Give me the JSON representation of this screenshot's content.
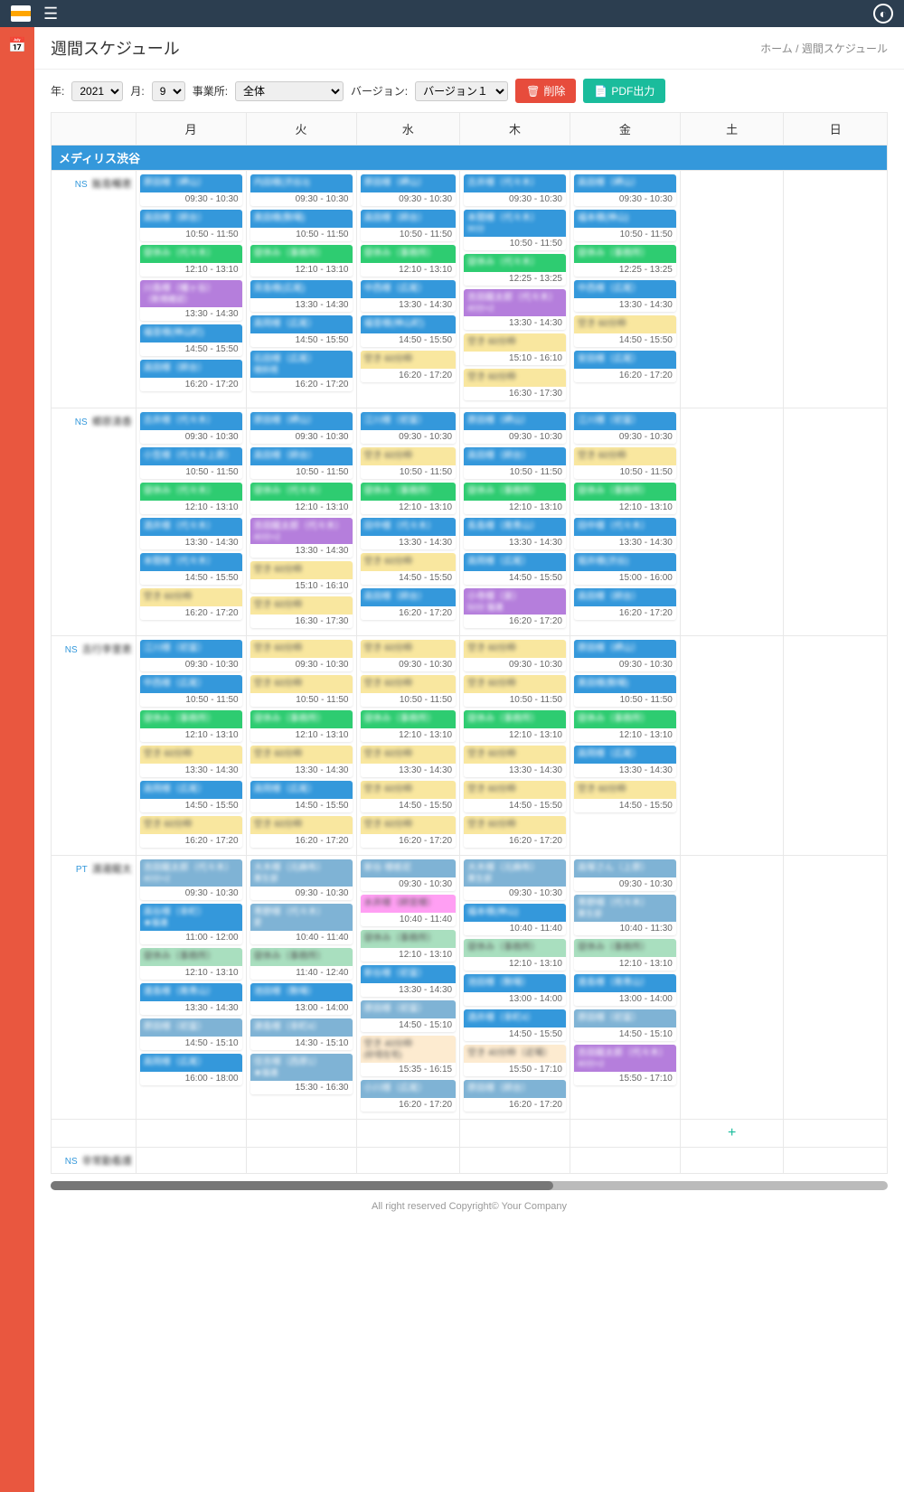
{
  "header": {
    "title": "週間スケジュール",
    "breadcrumb_home": "ホーム",
    "breadcrumb_sep": " / ",
    "breadcrumb_current": "週間スケジュール"
  },
  "toolbar": {
    "year_label": "年:",
    "year_value": "2021",
    "month_label": "月:",
    "month_value": "9",
    "office_label": "事業所:",
    "office_value": "全体",
    "version_label": "バージョン:",
    "version_value": "バージョン１",
    "delete_label": "削除",
    "pdf_label": "PDF出力"
  },
  "days": [
    "",
    "月",
    "火",
    "水",
    "木",
    "金",
    "土",
    "日"
  ],
  "group": {
    "name": "メディリス渋谷"
  },
  "staff": [
    {
      "tag": "NS",
      "name": "飯島暢恵",
      "days": [
        [
          {
            "c": "blue",
            "t": "原田様（岬山）",
            "time": "09:30 - 10:30"
          },
          {
            "c": "blue",
            "t": "高田様（師台）",
            "time": "10:50 - 11:50"
          },
          {
            "c": "green",
            "t": "昼休み（代々木）",
            "time": "12:10 - 13:10"
          },
          {
            "c": "purple",
            "t": "川島様（幡ヶ谷）",
            "s": "（新規確認）",
            "time": "13:30 - 14:30"
          },
          {
            "c": "blue",
            "t": "福音様(神山町)",
            "time": "14:50 - 15:50"
          },
          {
            "c": "blue",
            "t": "高田様（師台）",
            "time": "16:20 - 17:20"
          }
        ],
        [
          {
            "c": "blue",
            "t": "内田様(渋谷3)",
            "time": "09:30 - 10:30"
          },
          {
            "c": "blue",
            "t": "奥田様(駒場)",
            "time": "10:50 - 11:50"
          },
          {
            "c": "green",
            "t": "昼休み（事務所）",
            "time": "12:10 - 13:10"
          },
          {
            "c": "blue",
            "t": "貝島様(広尾)",
            "time": "13:30 - 14:30"
          },
          {
            "c": "blue",
            "t": "高岡様（広尾）",
            "time": "14:50 - 15:50"
          },
          {
            "c": "blue",
            "t": "石田様（広尾）",
            "s": "様斜視",
            "time": "16:20 - 17:20"
          }
        ],
        [
          {
            "c": "blue",
            "t": "原田様（岬山）",
            "time": "09:30 - 10:30"
          },
          {
            "c": "blue",
            "t": "高田様（師台）",
            "time": "10:50 - 11:50"
          },
          {
            "c": "green",
            "t": "昼休み（事務所）",
            "time": "12:10 - 13:10"
          },
          {
            "c": "blue",
            "t": "中西様（広尾）",
            "time": "13:30 - 14:30"
          },
          {
            "c": "blue",
            "t": "福音様(神山町)",
            "time": "14:50 - 15:50"
          },
          {
            "c": "yellow",
            "t": "空き 60分枠",
            "time": "16:20 - 17:20"
          }
        ],
        [
          {
            "c": "blue",
            "t": "古井様（代々木）",
            "time": "09:30 - 10:30"
          },
          {
            "c": "blue",
            "t": "本間様（代々木）",
            "s": "90分",
            "time": "10:50 - 11:50"
          },
          {
            "c": "green",
            "t": "昼休み（代々木）",
            "time": "12:25 - 13:25"
          },
          {
            "c": "purple",
            "t": "吉田龍太郎（代々木）",
            "s": "40分×2",
            "time": "13:30 - 14:30"
          },
          {
            "c": "yellow",
            "t": "空き 60分枠",
            "time": "15:10 - 16:10"
          },
          {
            "c": "yellow",
            "t": "空き 60分枠",
            "time": "16:30 - 17:30"
          }
        ],
        [
          {
            "c": "blue",
            "t": "高田様（岬山）",
            "time": "09:30 - 10:30"
          },
          {
            "c": "blue",
            "t": "福本様(神山)",
            "time": "10:50 - 11:50"
          },
          {
            "c": "green",
            "t": "昼休み（事務所）",
            "time": "12:25 - 13:25"
          },
          {
            "c": "blue",
            "t": "中西様（広尾）",
            "time": "13:30 - 14:30"
          },
          {
            "c": "yellow",
            "t": "空き 60分枠",
            "time": "14:50 - 15:50"
          },
          {
            "c": "blue",
            "t": "安田様（広尾）",
            "time": "16:20 - 17:20"
          }
        ],
        [],
        []
      ]
    },
    {
      "tag": "NS",
      "name": "郷原清香",
      "days": [
        [
          {
            "c": "blue",
            "t": "古井様（代々木）",
            "time": "09:30 - 10:30"
          },
          {
            "c": "blue",
            "t": "小笠様（代々木上原）",
            "time": "10:50 - 11:50"
          },
          {
            "c": "green",
            "t": "昼休み（代々木）",
            "time": "12:10 - 13:10"
          },
          {
            "c": "blue",
            "t": "酒井様（代々木）",
            "time": "13:30 - 14:30"
          },
          {
            "c": "blue",
            "t": "本間様（代々木）",
            "time": "14:50 - 15:50"
          },
          {
            "c": "yellow",
            "t": "空き 60分枠",
            "time": "16:20 - 17:20"
          }
        ],
        [
          {
            "c": "blue",
            "t": "原田様（岬山）",
            "time": "09:30 - 10:30"
          },
          {
            "c": "blue",
            "t": "高田様（師台）",
            "time": "10:50 - 11:50"
          },
          {
            "c": "green",
            "t": "昼休み（代々木）",
            "time": "12:10 - 13:10"
          },
          {
            "c": "purple",
            "t": "吉田龍太郎（代々木）",
            "s": "40分×2",
            "time": "13:30 - 14:30"
          },
          {
            "c": "yellow",
            "t": "空き 60分枠",
            "time": "15:10 - 16:10"
          },
          {
            "c": "yellow",
            "t": "空き 60分枠",
            "time": "16:30 - 17:30"
          }
        ],
        [
          {
            "c": "blue",
            "t": "江川様（初富）",
            "time": "09:30 - 10:30"
          },
          {
            "c": "yellow",
            "t": "空き 60分枠",
            "time": "10:50 - 11:50"
          },
          {
            "c": "green",
            "t": "昼休み（事務所）",
            "time": "12:10 - 13:10"
          },
          {
            "c": "blue",
            "t": "田中様（代々木）",
            "time": "13:30 - 14:30"
          },
          {
            "c": "yellow",
            "t": "空き 60分枠",
            "time": "14:50 - 15:50"
          },
          {
            "c": "blue",
            "t": "高田様（師台）",
            "time": "16:20 - 17:20"
          }
        ],
        [
          {
            "c": "blue",
            "t": "原田様（岬山）",
            "time": "09:30 - 10:30"
          },
          {
            "c": "blue",
            "t": "高田様（師台）",
            "time": "10:50 - 11:50"
          },
          {
            "c": "green",
            "t": "昼休み（事務所）",
            "time": "12:10 - 13:10"
          },
          {
            "c": "blue",
            "t": "長島様（南青山）",
            "time": "13:30 - 14:30"
          },
          {
            "c": "blue",
            "t": "高岡様（広尾）",
            "time": "14:50 - 15:50"
          },
          {
            "c": "purple",
            "t": "小寺様（泉）",
            "s": "50分 猫連",
            "time": "16:20 - 17:20"
          }
        ],
        [
          {
            "c": "blue",
            "t": "江川様（初富）",
            "time": "09:30 - 10:30"
          },
          {
            "c": "yellow",
            "t": "空き 60分枠",
            "time": "10:50 - 11:50"
          },
          {
            "c": "green",
            "t": "昼休み（事務所）",
            "time": "12:10 - 13:10"
          },
          {
            "c": "blue",
            "t": "田中様（代々木）",
            "time": "13:30 - 14:30"
          },
          {
            "c": "blue",
            "t": "堀井様(渋谷)",
            "time": "15:00 - 16:00"
          },
          {
            "c": "blue",
            "t": "高田様（師台）",
            "time": "16:20 - 17:20"
          }
        ],
        [],
        []
      ]
    },
    {
      "tag": "NS",
      "name": "吉行李里恵",
      "days": [
        [
          {
            "c": "blue",
            "t": "江川様（初富）",
            "time": "09:30 - 10:30"
          },
          {
            "c": "blue",
            "t": "中西様（広尾）",
            "time": "10:50 - 11:50"
          },
          {
            "c": "green",
            "t": "昼休み（事務所）",
            "time": "12:10 - 13:10"
          },
          {
            "c": "yellow",
            "t": "空き 60分枠",
            "time": "13:30 - 14:30"
          },
          {
            "c": "blue",
            "t": "高岡様（広尾）",
            "time": "14:50 - 15:50"
          },
          {
            "c": "yellow",
            "t": "空き 60分枠",
            "time": "16:20 - 17:20"
          }
        ],
        [
          {
            "c": "yellow",
            "t": "空き 60分枠",
            "time": "09:30 - 10:30"
          },
          {
            "c": "yellow",
            "t": "空き 60分枠",
            "time": "10:50 - 11:50"
          },
          {
            "c": "green",
            "t": "昼休み（事務所）",
            "time": "12:10 - 13:10"
          },
          {
            "c": "yellow",
            "t": "空き 60分枠",
            "time": "13:30 - 14:30"
          },
          {
            "c": "blue",
            "t": "高岡様（広尾）",
            "time": "14:50 - 15:50"
          },
          {
            "c": "yellow",
            "t": "空き 60分枠",
            "time": "16:20 - 17:20"
          }
        ],
        [
          {
            "c": "yellow",
            "t": "空き 60分枠",
            "time": "09:30 - 10:30"
          },
          {
            "c": "yellow",
            "t": "空き 60分枠",
            "time": "10:50 - 11:50"
          },
          {
            "c": "green",
            "t": "昼休み（事務所）",
            "time": "12:10 - 13:10"
          },
          {
            "c": "yellow",
            "t": "空き 60分枠",
            "time": "13:30 - 14:30"
          },
          {
            "c": "yellow",
            "t": "空き 60分枠",
            "time": "14:50 - 15:50"
          },
          {
            "c": "yellow",
            "t": "空き 60分枠",
            "time": "16:20 - 17:20"
          }
        ],
        [
          {
            "c": "yellow",
            "t": "空き 60分枠",
            "time": "09:30 - 10:30"
          },
          {
            "c": "yellow",
            "t": "空き 60分枠",
            "time": "10:50 - 11:50"
          },
          {
            "c": "green",
            "t": "昼休み（事務所）",
            "time": "12:10 - 13:10"
          },
          {
            "c": "yellow",
            "t": "空き 60分枠",
            "time": "13:30 - 14:30"
          },
          {
            "c": "yellow",
            "t": "空き 60分枠",
            "time": "14:50 - 15:50"
          },
          {
            "c": "yellow",
            "t": "空き 60分枠",
            "time": "16:20 - 17:20"
          }
        ],
        [
          {
            "c": "blue",
            "t": "原田様（岬山）",
            "time": "09:30 - 10:30"
          },
          {
            "c": "blue",
            "t": "奥田様(駒場)",
            "time": "10:50 - 11:50"
          },
          {
            "c": "green",
            "t": "昼休み（事務所）",
            "time": "12:10 - 13:10"
          },
          {
            "c": "blue",
            "t": "高岡様（広尾）",
            "time": "13:30 - 14:30"
          },
          {
            "c": "yellow",
            "t": "空き 60分枠",
            "time": "14:50 - 15:50"
          }
        ],
        [],
        []
      ]
    },
    {
      "tag": "PT",
      "name": "渡邊龍太",
      "days": [
        [
          {
            "c": "lblue",
            "t": "吉田龍太郎（代々木）",
            "s": "40分×2",
            "time": "09:30 - 10:30"
          },
          {
            "c": "blue",
            "t": "高谷様（幸町）",
            "s": "★猫連",
            "time": "11:00 - 12:00"
          },
          {
            "c": "lgreen",
            "t": "昼休み（事務所）",
            "time": "12:10 - 13:10"
          },
          {
            "c": "blue",
            "t": "遠島様（南青山）",
            "time": "13:30 - 14:30"
          },
          {
            "c": "lblue",
            "t": "原田様（初富）",
            "time": "14:50 - 15:10"
          },
          {
            "c": "blue",
            "t": "高岡様（広尾）",
            "time": "16:00 - 18:00"
          }
        ],
        [
          {
            "c": "lblue",
            "t": "大木様（元麻布）",
            "s": "果生部",
            "time": "09:30 - 10:30"
          },
          {
            "c": "lblue",
            "t": "青野様（代々木）",
            "s": "愛",
            "time": "10:40 - 11:40"
          },
          {
            "c": "lgreen",
            "t": "昼休み（事務所）",
            "time": "11:40 - 12:40"
          },
          {
            "c": "blue",
            "t": "池田様（駒場）",
            "time": "13:00 - 14:00"
          },
          {
            "c": "lblue",
            "t": "源島様（幸町4）",
            "time": "14:30 - 15:10"
          },
          {
            "c": "lblue",
            "t": "住吉様（西原1）",
            "s": "★猫連",
            "time": "15:30 - 16:30"
          }
        ],
        [
          {
            "c": "lblue",
            "t": "新谷 様栃尼",
            "time": "09:30 - 10:30"
          },
          {
            "c": "pink",
            "t": "水井様（師宮様）",
            "time": "10:40 - 11:40"
          },
          {
            "c": "lgreen",
            "t": "昼休み（事務所）",
            "time": "12:10 - 13:10"
          },
          {
            "c": "blue",
            "t": "新谷様（初富）",
            "time": "13:30 - 14:30"
          },
          {
            "c": "lblue",
            "t": "原田様（初富）",
            "time": "14:50 - 15:10"
          },
          {
            "c": "lyellow",
            "t": "空き 40分枠",
            "s": "(砂塔在宅)",
            "time": "15:35 - 16:15"
          },
          {
            "c": "lblue",
            "t": "小川様（広尾）",
            "time": "16:20 - 17:20"
          }
        ],
        [
          {
            "c": "lblue",
            "t": "大木様（元麻布）",
            "s": "果生部",
            "time": "09:30 - 10:30"
          },
          {
            "c": "blue",
            "t": "福本様(神山)",
            "time": "10:40 - 11:40"
          },
          {
            "c": "lgreen",
            "t": "昼休み（事務所）",
            "time": "12:10 - 13:10"
          },
          {
            "c": "blue",
            "t": "池田様（駒場）",
            "time": "13:00 - 14:00"
          },
          {
            "c": "blue",
            "t": "酒井様（幸町4）",
            "time": "14:50 - 15:50"
          },
          {
            "c": "lyellow",
            "t": "空き 40分枠（近場）",
            "time": "15:50 - 17:10"
          },
          {
            "c": "lblue",
            "t": "原田様（師台）",
            "time": "16:20 - 17:20"
          }
        ],
        [
          {
            "c": "lblue",
            "t": "高塚さん（上原）",
            "time": "09:30 - 10:30"
          },
          {
            "c": "lblue",
            "t": "青野様（代々木）",
            "s": "果生部",
            "time": "10:40 - 11:30"
          },
          {
            "c": "lgreen",
            "t": "昼休み（事務所）",
            "time": "12:10 - 13:10"
          },
          {
            "c": "blue",
            "t": "遠島様（南青山）",
            "time": "13:00 - 14:00"
          },
          {
            "c": "lblue",
            "t": "原田様（初富）",
            "time": "14:50 - 15:10"
          },
          {
            "c": "purple",
            "t": "吉田龍太郎（代々木）",
            "s": "40分×2",
            "time": "15:50 - 17:10"
          }
        ],
        [],
        []
      ]
    },
    {
      "tag": "NS",
      "name": "非常勤看護",
      "days": [
        [],
        [],
        [],
        [],
        [],
        [],
        []
      ]
    }
  ],
  "footer": "All right reserved Copyright© Your Company"
}
